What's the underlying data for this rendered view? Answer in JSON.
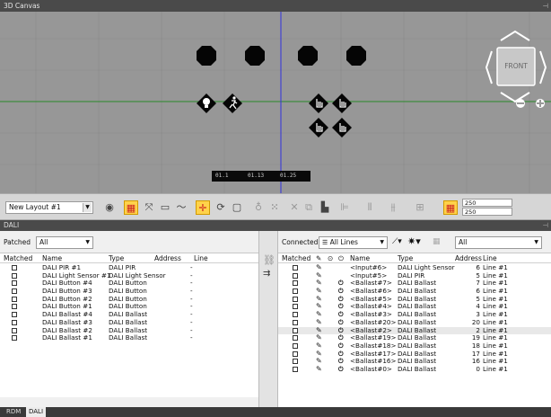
{
  "window": {
    "title": "3D Canvas",
    "pin_icon": "pin-icon"
  },
  "canvas": {
    "view_cube_label": "FRONT",
    "timeline_labels": [
      "01.1",
      "01.13",
      "01.25"
    ]
  },
  "toolbar": {
    "layout_select": "New Layout #1",
    "width_value": "250",
    "height_value": "250"
  },
  "dali_panel": {
    "title": "DALI"
  },
  "left": {
    "filter_label": "Patched",
    "filter_value": "All",
    "columns": [
      "Matched",
      "Name",
      "Type",
      "Address",
      "Line"
    ],
    "rows": [
      {
        "name": "DALI PIR #1",
        "type": "DALI PIR",
        "address": "-",
        "line": ""
      },
      {
        "name": "DALI Light Sensor #1",
        "type": "DALI Light Sensor",
        "address": "-",
        "line": ""
      },
      {
        "name": "DALI Button #4",
        "type": "DALI Button",
        "address": "-",
        "line": ""
      },
      {
        "name": "DALI Button #3",
        "type": "DALI Button",
        "address": "-",
        "line": ""
      },
      {
        "name": "DALI Button #2",
        "type": "DALI Button",
        "address": "-",
        "line": ""
      },
      {
        "name": "DALI Button #1",
        "type": "DALI Button",
        "address": "-",
        "line": ""
      },
      {
        "name": "DALI Ballast #4",
        "type": "DALI Ballast",
        "address": "-",
        "line": ""
      },
      {
        "name": "DALI Ballast #3",
        "type": "DALI Ballast",
        "address": "-",
        "line": ""
      },
      {
        "name": "DALI Ballast #2",
        "type": "DALI Ballast",
        "address": "-",
        "line": ""
      },
      {
        "name": "DALI Ballast #1",
        "type": "DALI Ballast",
        "address": "-",
        "line": ""
      }
    ]
  },
  "right": {
    "filter_label": "Connected",
    "lines_value": "All Lines",
    "type_filter_value": "All",
    "columns": [
      "Matched",
      "Name",
      "Type",
      "Address",
      "Line"
    ],
    "rows": [
      {
        "name": "<Input#6>",
        "type": "DALI Light Sensor",
        "address": "6",
        "line": "Line #1",
        "power": false
      },
      {
        "name": "<Input#5>",
        "type": "DALI PIR",
        "address": "5",
        "line": "Line #1",
        "power": false
      },
      {
        "name": "<Ballast#7>",
        "type": "DALI Ballast",
        "address": "7",
        "line": "Line #1",
        "power": true
      },
      {
        "name": "<Ballast#6>",
        "type": "DALI Ballast",
        "address": "6",
        "line": "Line #1",
        "power": true
      },
      {
        "name": "<Ballast#5>",
        "type": "DALI Ballast",
        "address": "5",
        "line": "Line #1",
        "power": true
      },
      {
        "name": "<Ballast#4>",
        "type": "DALI Ballast",
        "address": "4",
        "line": "Line #1",
        "power": true
      },
      {
        "name": "<Ballast#3>",
        "type": "DALI Ballast",
        "address": "3",
        "line": "Line #1",
        "power": true
      },
      {
        "name": "<Ballast#20>",
        "type": "DALI Ballast",
        "address": "20",
        "line": "Line #1",
        "power": true
      },
      {
        "name": "<Ballast#2>",
        "type": "DALI Ballast",
        "address": "2",
        "line": "Line #1",
        "power": true,
        "selected": true
      },
      {
        "name": "<Ballast#19>",
        "type": "DALI Ballast",
        "address": "19",
        "line": "Line #1",
        "power": true
      },
      {
        "name": "<Ballast#18>",
        "type": "DALI Ballast",
        "address": "18",
        "line": "Line #1",
        "power": true
      },
      {
        "name": "<Ballast#17>",
        "type": "DALI Ballast",
        "address": "17",
        "line": "Line #1",
        "power": true
      },
      {
        "name": "<Ballast#16>",
        "type": "DALI Ballast",
        "address": "16",
        "line": "Line #1",
        "power": true
      },
      {
        "name": "<Ballast#0>",
        "type": "DALI Ballast",
        "address": "0",
        "line": "Line #1",
        "power": true
      }
    ]
  },
  "bottom_tabs": [
    {
      "label": "RDM",
      "active": false
    },
    {
      "label": "DALI",
      "active": true
    }
  ],
  "colors": {
    "canvas_bg": "#979797",
    "selected_tool": "#ffd24a",
    "axis_blue": "#3333dd",
    "axis_green": "#2a8a2a"
  }
}
